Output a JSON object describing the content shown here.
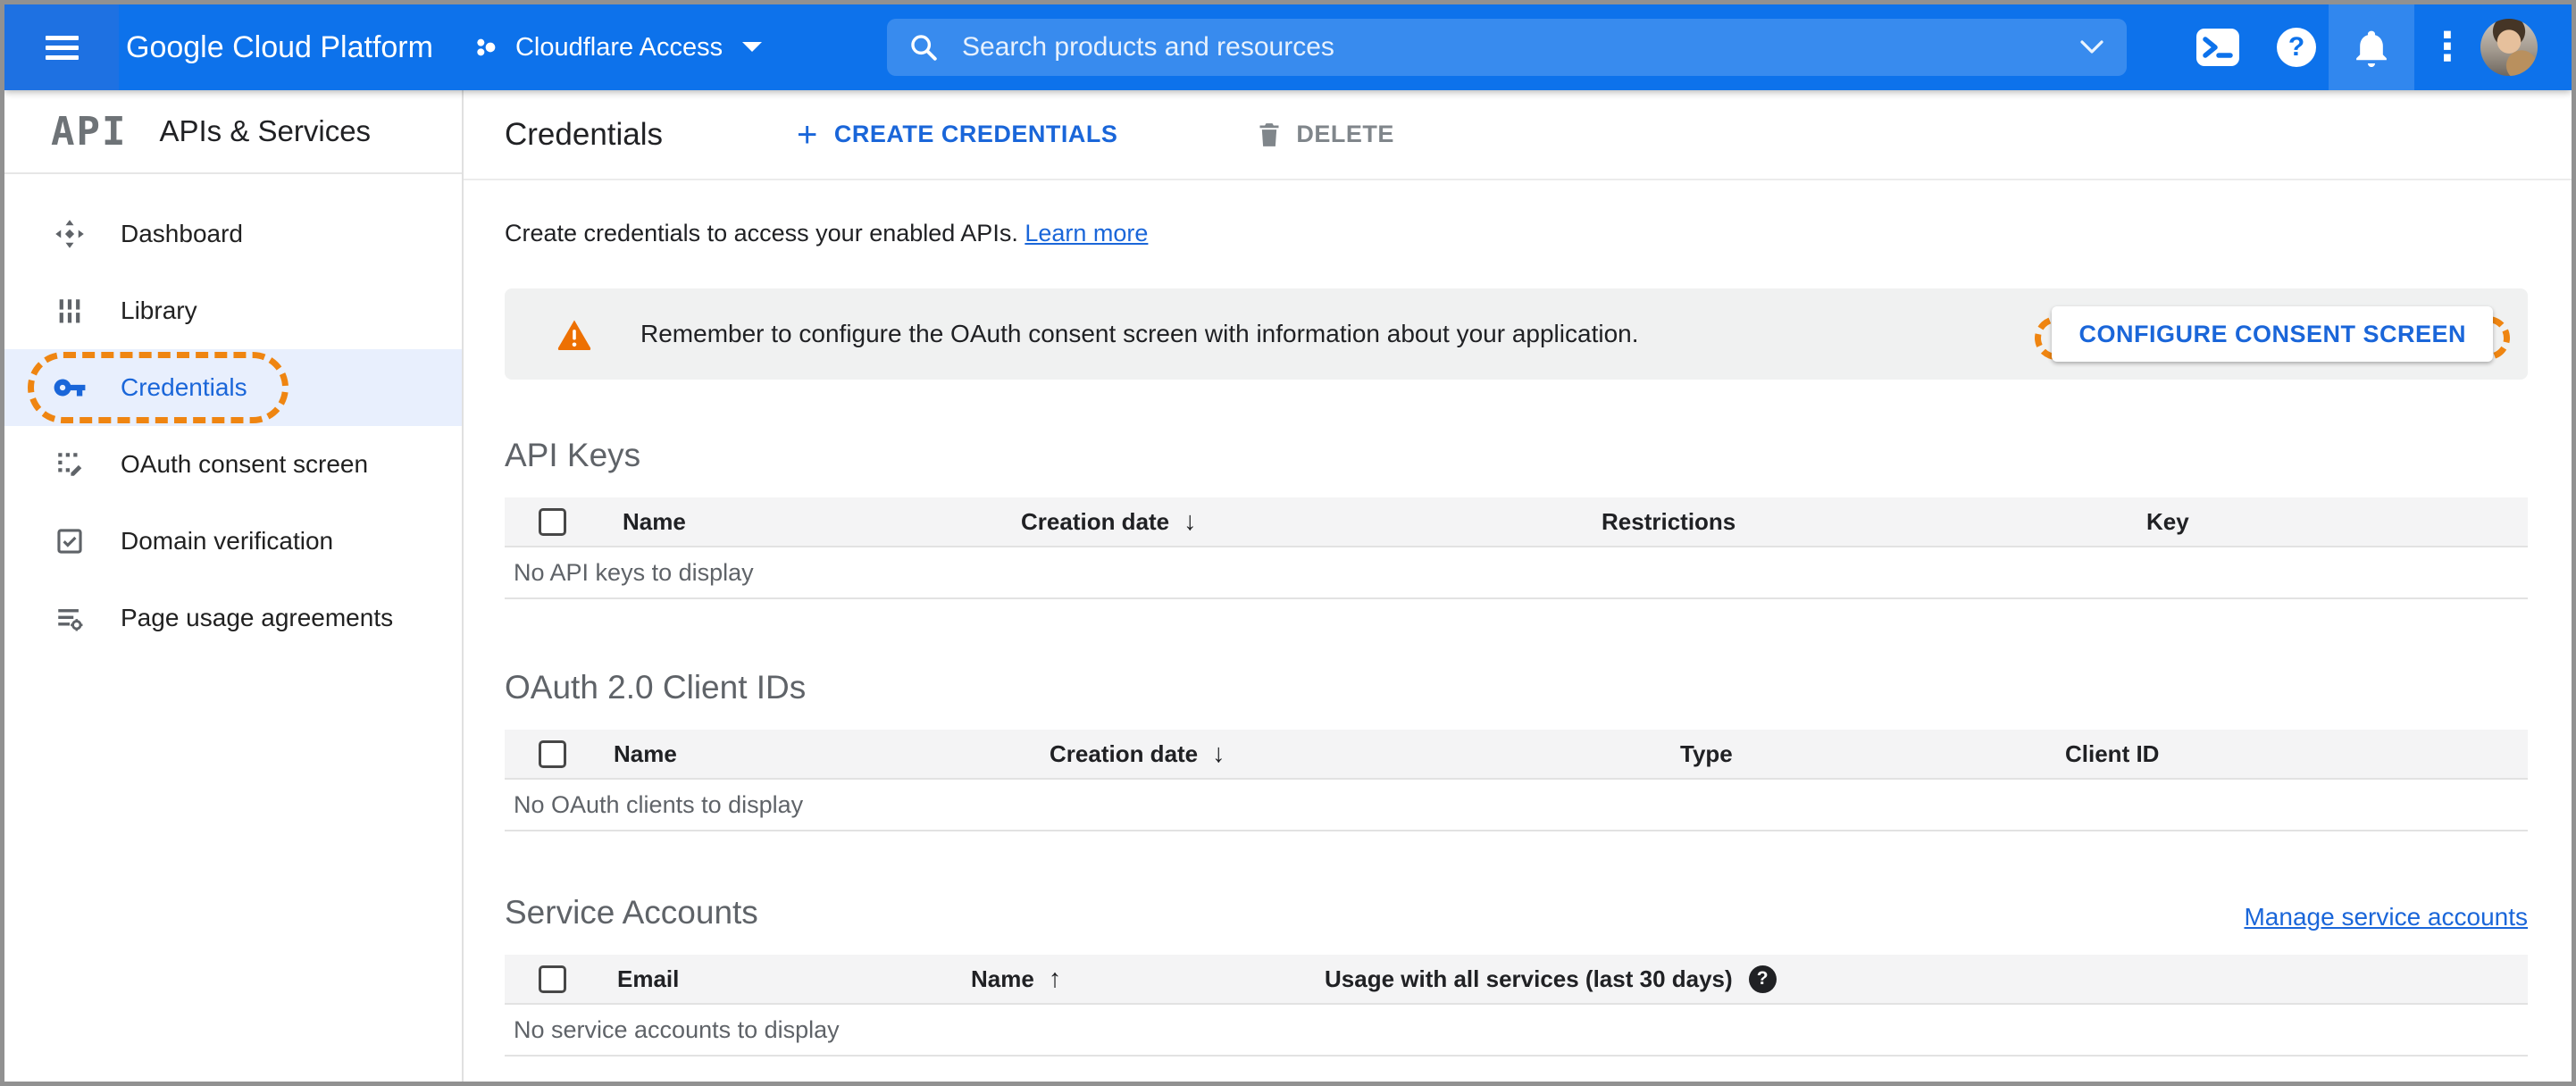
{
  "topbar": {
    "brand": "Google Cloud Platform",
    "project_selector": "Cloudflare Access",
    "search_placeholder": "Search products and resources"
  },
  "sidebar": {
    "logo_text": "API",
    "title": "APIs & Services",
    "items": [
      {
        "label": "Dashboard",
        "selected": false
      },
      {
        "label": "Library",
        "selected": false
      },
      {
        "label": "Credentials",
        "selected": true,
        "annotated": true
      },
      {
        "label": "OAuth consent screen",
        "selected": false
      },
      {
        "label": "Domain verification",
        "selected": false
      },
      {
        "label": "Page usage agreements",
        "selected": false
      }
    ]
  },
  "toolbar": {
    "title": "Credentials",
    "create_label": "CREATE CREDENTIALS",
    "delete_label": "DELETE"
  },
  "intro": {
    "text": "Create credentials to access your enabled APIs.",
    "link_label": "Learn more"
  },
  "banner": {
    "message": "Remember to configure the OAuth consent screen with information about your application.",
    "button_label": "CONFIGURE CONSENT SCREEN"
  },
  "sections": {
    "api_keys": {
      "title": "API Keys",
      "columns": {
        "name": "Name",
        "creation": "Creation date",
        "restrictions": "Restrictions",
        "key": "Key"
      },
      "sort": "creation date descending",
      "empty": "No API keys to display"
    },
    "oauth": {
      "title": "OAuth 2.0 Client IDs",
      "columns": {
        "name": "Name",
        "creation": "Creation date",
        "type": "Type",
        "client_id": "Client ID"
      },
      "sort": "creation date descending",
      "empty": "No OAuth clients to display"
    },
    "service_accounts": {
      "title": "Service Accounts",
      "manage_link": "Manage service accounts",
      "columns": {
        "email": "Email",
        "name": "Name",
        "usage": "Usage with all services (last 30 days)"
      },
      "sort": "name ascending",
      "empty": "No service accounts to display"
    }
  },
  "icons": {
    "sort_desc": "↓",
    "sort_asc": "↑",
    "help_badge": "?",
    "more_vert": "⋮",
    "plus": "+"
  },
  "colors": {
    "topbar_blue": "#0d72eb",
    "link_blue": "#1a66d9",
    "annotation_orange": "#ef8511",
    "selected_item_bg": "#e8effd",
    "banner_bg": "#f0f1f1",
    "warning_orange": "#ed7002"
  }
}
